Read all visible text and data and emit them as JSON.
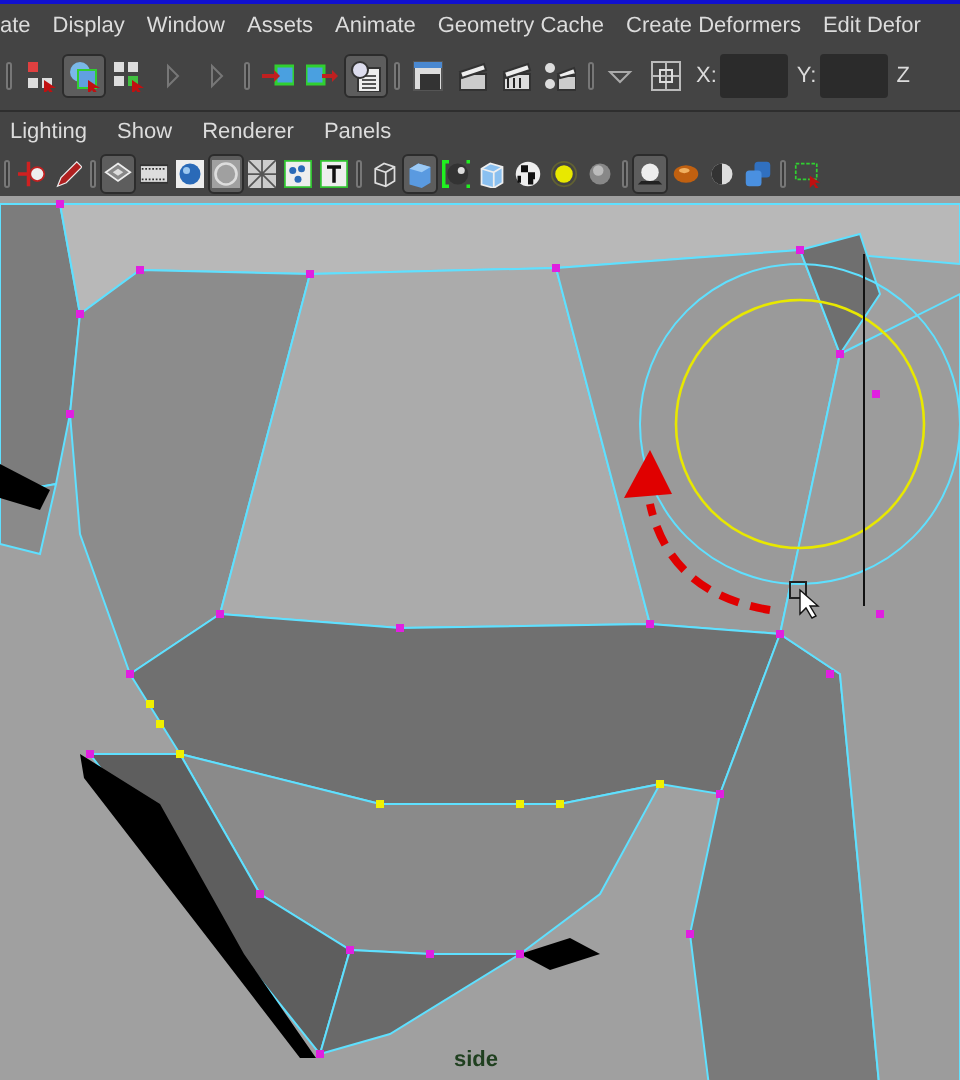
{
  "menu_bar": [
    "ate",
    "Display",
    "Window",
    "Assets",
    "Animate",
    "Geometry Cache",
    "Create Deformers",
    "Edit Defor"
  ],
  "toolbar": {
    "groups": [
      {
        "items": [
          {
            "kind": "hierarchy",
            "pressed": false
          },
          {
            "kind": "object",
            "pressed": true
          },
          {
            "kind": "component",
            "pressed": false
          },
          {
            "kind": "collapse",
            "pressed": false
          },
          {
            "kind": "collapse",
            "pressed": false
          }
        ]
      },
      {
        "items": [
          {
            "kind": "input",
            "pressed": false
          },
          {
            "kind": "output",
            "pressed": false
          },
          {
            "kind": "history",
            "pressed": true
          }
        ]
      },
      {
        "items": [
          {
            "kind": "render-view",
            "pressed": false
          },
          {
            "kind": "clapper",
            "pressed": false
          },
          {
            "kind": "ipr",
            "pressed": false
          },
          {
            "kind": "render-settings",
            "pressed": false
          }
        ]
      },
      {
        "items": [
          {
            "kind": "dropdown",
            "pressed": false
          },
          {
            "kind": "snap-grid",
            "pressed": false
          }
        ]
      }
    ],
    "fields": [
      {
        "label": "X:"
      },
      {
        "label": "Y:"
      },
      {
        "label": "Z"
      }
    ]
  },
  "panel_menu": [
    "Lighting",
    "Show",
    "Renderer",
    "Panels"
  ],
  "panel_toolbar": {
    "groups": [
      {
        "items": [
          {
            "kind": "camera-attr",
            "pressed": false
          },
          {
            "kind": "pencil",
            "pressed": false
          }
        ]
      },
      {
        "items": [
          {
            "kind": "grid-plane",
            "pressed": true
          },
          {
            "kind": "film",
            "pressed": false
          },
          {
            "kind": "blue-sphere",
            "pressed": false
          },
          {
            "kind": "ring",
            "pressed": true
          },
          {
            "kind": "xray",
            "pressed": false
          },
          {
            "kind": "dots",
            "pressed": false
          },
          {
            "kind": "text",
            "pressed": false
          }
        ]
      },
      {
        "items": [
          {
            "kind": "wire-cube",
            "pressed": false
          },
          {
            "kind": "shaded-cube",
            "pressed": true
          },
          {
            "kind": "smooth",
            "pressed": false
          },
          {
            "kind": "light-cube",
            "pressed": false
          },
          {
            "kind": "checker",
            "pressed": false
          },
          {
            "kind": "light",
            "pressed": false
          },
          {
            "kind": "gray-sphere",
            "pressed": false
          }
        ]
      },
      {
        "items": [
          {
            "kind": "shadow",
            "pressed": true
          },
          {
            "kind": "orange-sphere",
            "pressed": false
          },
          {
            "kind": "half-sphere",
            "pressed": false
          },
          {
            "kind": "blue-cubes",
            "pressed": false
          }
        ]
      },
      {
        "items": [
          {
            "kind": "marquee",
            "pressed": false
          }
        ]
      }
    ]
  },
  "viewport": {
    "label": "side"
  }
}
